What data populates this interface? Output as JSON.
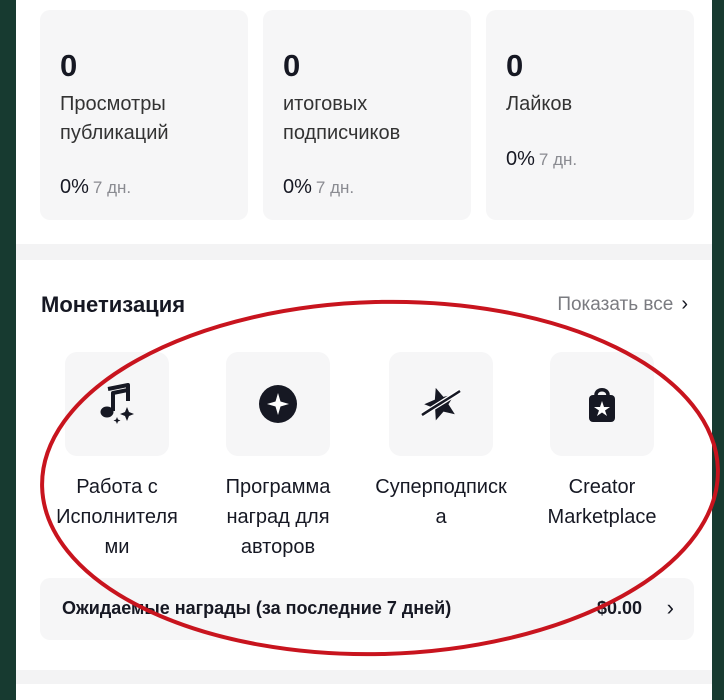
{
  "stats": [
    {
      "value": "0",
      "label": "Просмотры публикаций",
      "pct": "0%",
      "period": "7 дн."
    },
    {
      "value": "0",
      "label": "итоговых подписчиков",
      "pct": "0%",
      "period": "7 дн."
    },
    {
      "value": "0",
      "label": "Лайков",
      "pct": "0%",
      "period": "7 дн."
    }
  ],
  "monetization": {
    "title": "Монетизация",
    "show_all": "Показать все",
    "items": [
      {
        "label": "Работа с Исполнителя ми",
        "icon": "music-note-sparkle-icon"
      },
      {
        "label": "Программа наград для авторов",
        "icon": "star-circle-icon"
      },
      {
        "label": "Суперподписк а",
        "icon": "star-orbit-icon"
      },
      {
        "label": "Creator Marketplace",
        "icon": "shopping-bag-star-icon"
      }
    ],
    "rewards": {
      "label": "Ожидаемые награды (за последние 7 дней)",
      "amount": "$0.00"
    }
  },
  "annotation_color": "#c8141e"
}
